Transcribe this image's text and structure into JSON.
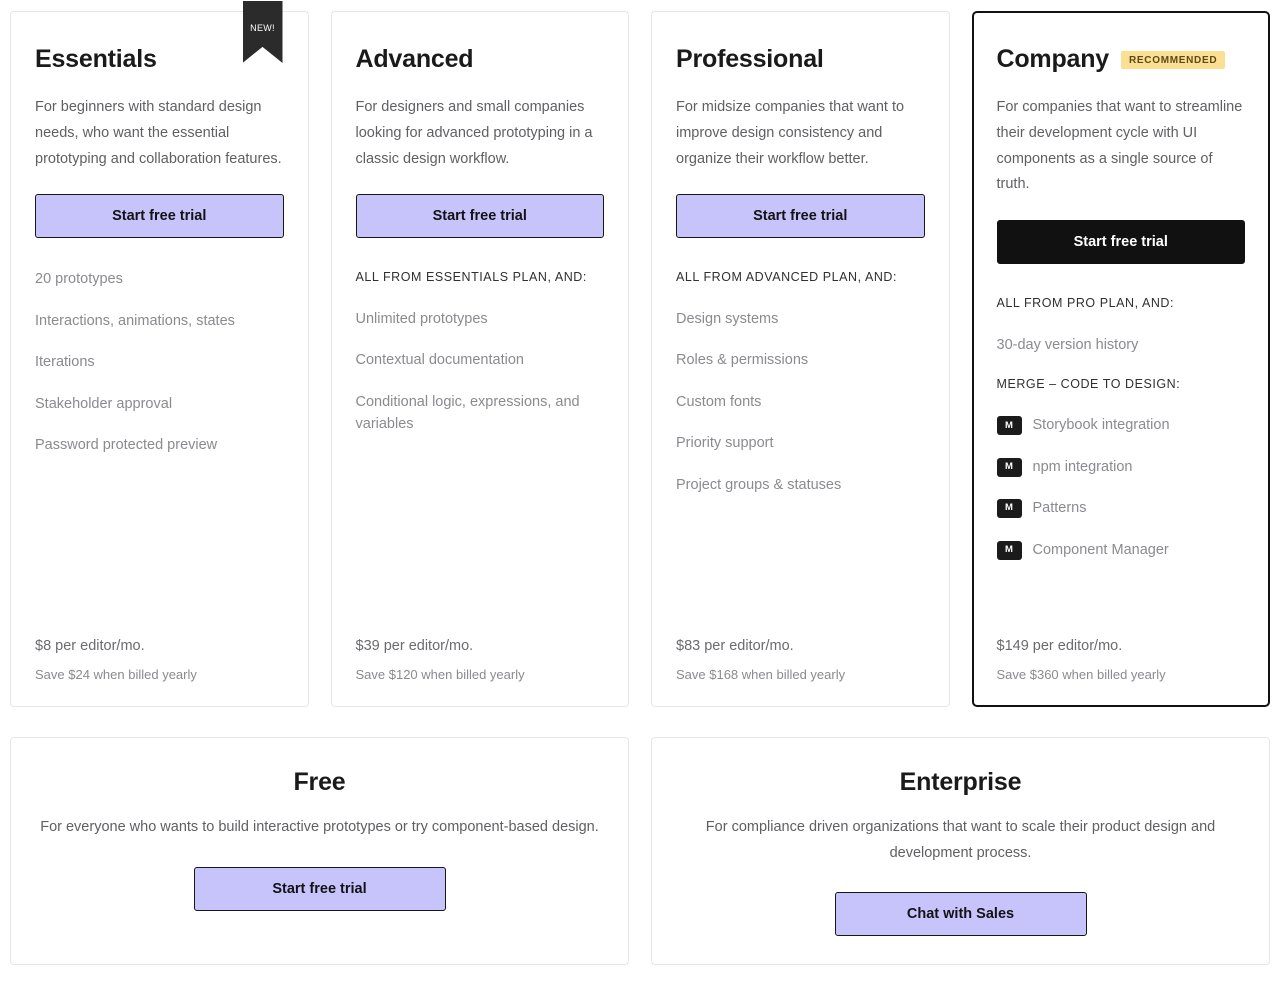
{
  "colors": {
    "accent_button": "#C7C4FB",
    "featured_button": "#111111",
    "recommended_badge": "#FBDF93",
    "new_ribbon": "#2B2B2B",
    "card_border": "#E6E6E6",
    "featured_border": "#111111"
  },
  "plans": [
    {
      "name": "Essentials",
      "ribbon": "NEW!",
      "description": "For beginners with standard design needs, who want the essential prototyping and collaboration features.",
      "cta": "Start free trial",
      "features": [
        {
          "text": "20 prototypes",
          "type": "item"
        },
        {
          "text": "Interactions, animations, states",
          "type": "item"
        },
        {
          "text": "Iterations",
          "type": "item"
        },
        {
          "text": "Stakeholder approval",
          "type": "item"
        },
        {
          "text": "Password protected preview",
          "type": "item"
        }
      ],
      "price": "$8 per editor/mo.",
      "savings": "Save $24 when billed yearly"
    },
    {
      "name": "Advanced",
      "description": "For designers and small companies looking for advanced prototyping in a classic design workflow.",
      "cta": "Start free trial",
      "features": [
        {
          "text": "ALL FROM ESSENTIALS PLAN, AND:",
          "type": "heading"
        },
        {
          "text": "Unlimited prototypes",
          "type": "item"
        },
        {
          "text": "Contextual documentation",
          "type": "item"
        },
        {
          "text": "Conditional logic, expressions, and variables",
          "type": "item"
        }
      ],
      "price": "$39 per editor/mo.",
      "savings": "Save $120 when billed yearly"
    },
    {
      "name": "Professional",
      "description": "For midsize companies that want to improve design consistency and organize their workflow better.",
      "cta": "Start free trial",
      "features": [
        {
          "text": "ALL FROM ADVANCED PLAN, AND:",
          "type": "heading"
        },
        {
          "text": "Design systems",
          "type": "item"
        },
        {
          "text": "Roles & permissions",
          "type": "item"
        },
        {
          "text": "Custom fonts",
          "type": "item"
        },
        {
          "text": "Priority support",
          "type": "item"
        },
        {
          "text": "Project groups & statuses",
          "type": "item"
        }
      ],
      "price": "$83 per editor/mo.",
      "savings": "Save $168 when billed yearly"
    },
    {
      "name": "Company",
      "badge": "RECOMMENDED",
      "featured": true,
      "description": "For companies that want to streamline their development cycle with UI components as a single source of truth.",
      "cta": "Start free trial",
      "features": [
        {
          "text": "ALL FROM PRO PLAN, AND:",
          "type": "heading"
        },
        {
          "text": "30-day version history",
          "type": "item"
        },
        {
          "text": "MERGE – CODE TO DESIGN:",
          "type": "heading"
        },
        {
          "text": "Storybook integration",
          "type": "merge",
          "icon": "M"
        },
        {
          "text": "npm integration",
          "type": "merge",
          "icon": "M"
        },
        {
          "text": "Patterns",
          "type": "merge",
          "icon": "M"
        },
        {
          "text": "Component Manager",
          "type": "merge",
          "icon": "M"
        }
      ],
      "price": "$149 per editor/mo.",
      "savings": "Save $360 when billed yearly"
    }
  ],
  "wide_plans": [
    {
      "name": "Free",
      "description": "For everyone who wants to build interactive prototypes or try component-based design.",
      "cta": "Start free trial"
    },
    {
      "name": "Enterprise",
      "description": "For compliance driven organizations that want to scale their product design and development process.",
      "cta": "Chat with Sales"
    }
  ]
}
